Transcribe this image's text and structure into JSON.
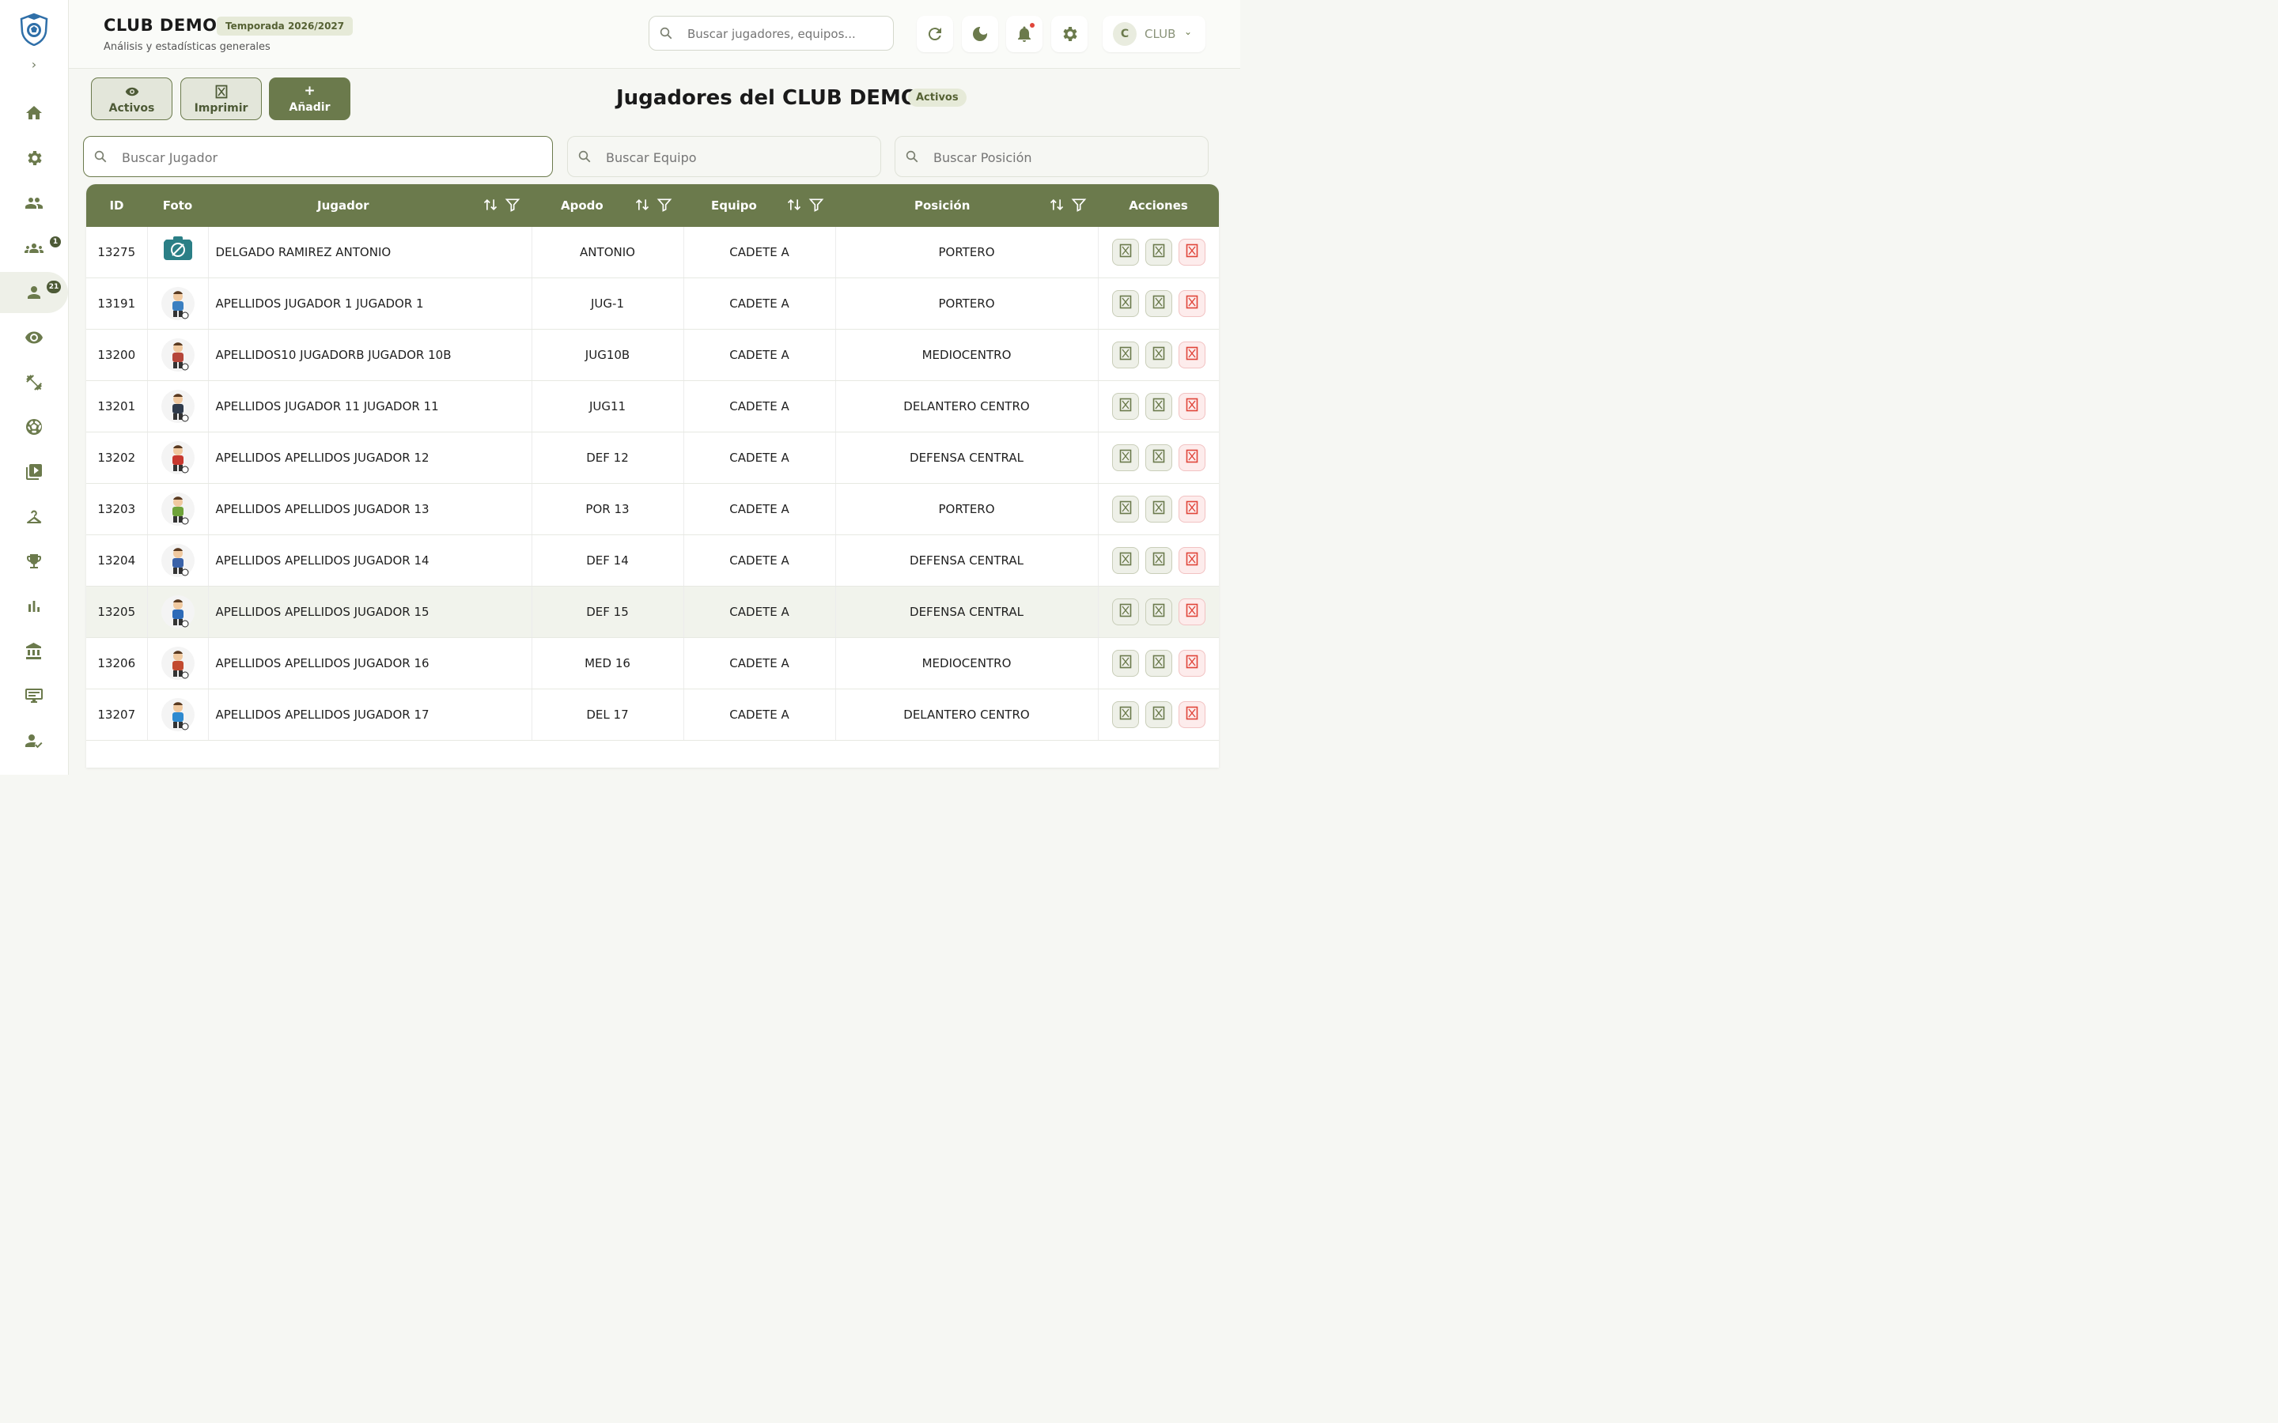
{
  "header": {
    "title": "CLUB DEMO",
    "season": "Temporada 2026/2027",
    "subtitle": "Análisis y estadísticas generales",
    "search_placeholder": "Buscar jugadores, equipos...",
    "user_initial": "C",
    "user_name": "CLUB"
  },
  "sidebar": {
    "items": [
      {
        "icon": "home-icon"
      },
      {
        "icon": "gear-icon"
      },
      {
        "icon": "people-icon"
      },
      {
        "icon": "groups-icon",
        "badge": "1"
      },
      {
        "icon": "person-icon",
        "badge": "21",
        "active": true
      },
      {
        "icon": "eye-icon"
      },
      {
        "icon": "fitness-icon"
      },
      {
        "icon": "soccer-ball-icon"
      },
      {
        "icon": "video-library-icon"
      },
      {
        "icon": "hanger-icon"
      },
      {
        "icon": "trophy-icon"
      },
      {
        "icon": "bar-chart-icon"
      },
      {
        "icon": "institution-icon"
      },
      {
        "icon": "scoreboard-icon"
      },
      {
        "icon": "person-check-icon"
      }
    ]
  },
  "toolbar": {
    "active_label": "Activos",
    "print_label": "Imprimir",
    "add_label": "Añadir",
    "add_symbol": "+"
  },
  "page": {
    "title": "Jugadores del CLUB DEMO",
    "badge": "Activos"
  },
  "filters": {
    "player_placeholder": "Buscar Jugador",
    "team_placeholder": "Buscar Equipo",
    "position_placeholder": "Buscar Posición"
  },
  "table": {
    "columns": {
      "id": "ID",
      "photo": "Foto",
      "player": "Jugador",
      "nickname": "Apodo",
      "team": "Equipo",
      "position": "Posición",
      "actions": "Acciones"
    },
    "rows": [
      {
        "id": "13275",
        "name": "DELGADO RAMIREZ ANTONIO",
        "nickname": "ANTONIO",
        "team": "CADETE A",
        "position": "PORTERO"
      },
      {
        "id": "13191",
        "name": "APELLIDOS JUGADOR 1 JUGADOR 1",
        "nickname": "JUG-1",
        "team": "CADETE A",
        "position": "PORTERO"
      },
      {
        "id": "13200",
        "name": "APELLIDOS10 JUGADORB JUGADOR 10B",
        "nickname": "JUG10B",
        "team": "CADETE A",
        "position": "MEDIOCENTRO"
      },
      {
        "id": "13201",
        "name": "APELLIDOS JUGADOR 11 JUGADOR 11",
        "nickname": "JUG11",
        "team": "CADETE A",
        "position": "DELANTERO CENTRO"
      },
      {
        "id": "13202",
        "name": "APELLIDOS APELLIDOS JUGADOR 12",
        "nickname": "DEF 12",
        "team": "CADETE A",
        "position": "DEFENSA CENTRAL"
      },
      {
        "id": "13203",
        "name": "APELLIDOS APELLIDOS JUGADOR 13",
        "nickname": "POR 13",
        "team": "CADETE A",
        "position": "PORTERO"
      },
      {
        "id": "13204",
        "name": "APELLIDOS APELLIDOS JUGADOR 14",
        "nickname": "DEF 14",
        "team": "CADETE A",
        "position": "DEFENSA CENTRAL"
      },
      {
        "id": "13205",
        "name": "APELLIDOS APELLIDOS JUGADOR 15",
        "nickname": "DEF 15",
        "team": "CADETE A",
        "position": "DEFENSA CENTRAL"
      },
      {
        "id": "13206",
        "name": "APELLIDOS APELLIDOS JUGADOR 16",
        "nickname": "MED 16",
        "team": "CADETE A",
        "position": "MEDIOCENTRO"
      },
      {
        "id": "13207",
        "name": "APELLIDOS APELLIDOS JUGADOR 17",
        "nickname": "DEL 17",
        "team": "CADETE A",
        "position": "DELANTERO CENTRO"
      }
    ]
  },
  "colors": {
    "accent": "#6b7a4c",
    "danger": "#e0453a"
  }
}
